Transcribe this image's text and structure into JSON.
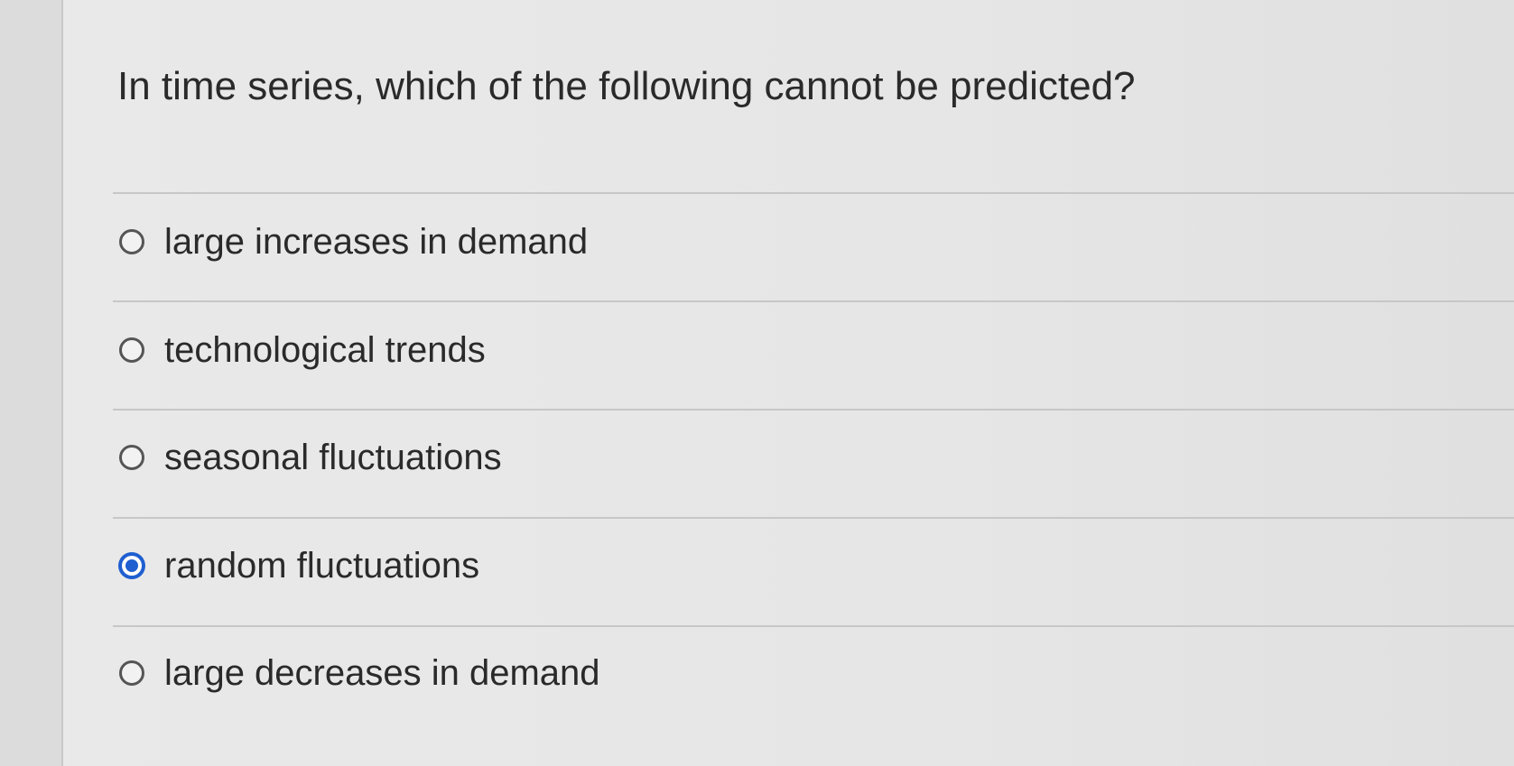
{
  "question": {
    "text": "In time series, which of the following cannot be predicted?"
  },
  "options": [
    {
      "label": "large increases in demand",
      "selected": false
    },
    {
      "label": "technological trends",
      "selected": false
    },
    {
      "label": "seasonal fluctuations",
      "selected": false
    },
    {
      "label": "random fluctuations",
      "selected": true
    },
    {
      "label": "large decreases in demand",
      "selected": false
    }
  ],
  "colors": {
    "accent": "#1f5fd0",
    "background": "#e6e6e6",
    "text": "#2a2a2a"
  }
}
